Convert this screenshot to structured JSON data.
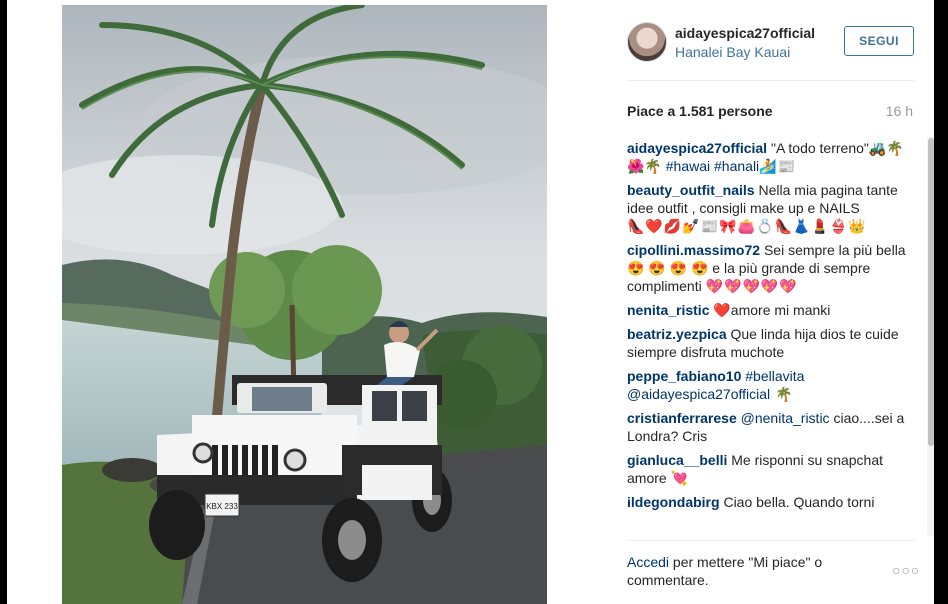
{
  "post": {
    "username": "aidayespica27official",
    "location": "Hanalei Bay Kauai",
    "follow_label": "SEGUI",
    "likes": "Piace a 1.581 persone",
    "time": "16 h",
    "plate": "KBX 233",
    "vehicle_brand": "Jeep"
  },
  "comments": [
    {
      "author": "aidayespica27official",
      "text": "\"A todo terreno\"🚜🌴🌺🌴 ",
      "tags": "#hawai #hanali",
      "emoji": "🏄📰"
    },
    {
      "author": "beauty_outfit_nails",
      "text": "Nella mia pagina tante idee outfit , consigli make up e NAILS",
      "emoji": "👠❤️💋💅📰🎀👛💍👠👗💄👙👑"
    },
    {
      "author": "cipollini.massimo72",
      "text": "Sei sempre la più bella 😍 😍 😍 😍 e la più grande di sempre complimenti ",
      "emoji": "💖💖💖💖💖"
    },
    {
      "author": "nenita_ristic",
      "text": "❤️amore mi manki"
    },
    {
      "author": "beatriz.yezpica",
      "text": "Que linda hija dios te cuide siempre disfruta muchote"
    },
    {
      "author": "peppe_fabiano10",
      "text": "",
      "tags": "#bellavita @aidayespica27official",
      "emoji": " 🌴"
    },
    {
      "author": "cristianferrarese",
      "tags": "@nenita_ristic",
      "text": " ciao....sei a Londra? Cris"
    },
    {
      "author": "gianluca__belli",
      "text": "Me risponni su snapchat amore 💘"
    },
    {
      "author": "ildegondabirg",
      "text": "Ciao bella. Quando torni"
    }
  ],
  "footer": {
    "login_link": "Accedi",
    "rest": " per mettere \"Mi piace\" o commentare.",
    "more": "○○○"
  },
  "colors": {
    "link": "#3f729b",
    "author": "#003569",
    "muted": "#999999"
  }
}
